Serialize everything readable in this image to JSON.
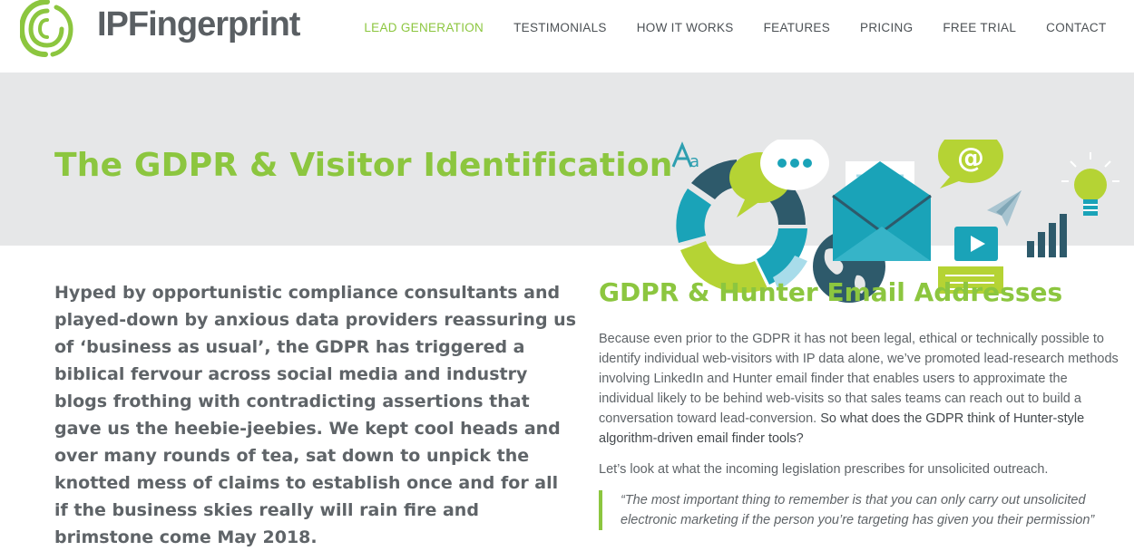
{
  "brand": {
    "logo_ip": "IP",
    "logo_fingerprint": "Fingerprint",
    "colors": {
      "accent_green": "#8cc63f",
      "dark_teal": "#2e5a6b",
      "teal": "#1aa3b8",
      "gray_text": "#5f6468",
      "hero_bg": "#e6e7e8"
    }
  },
  "nav": {
    "items": [
      {
        "label": "LEAD GENERATION",
        "active": true
      },
      {
        "label": "TESTIMONIALS"
      },
      {
        "label": "HOW IT WORKS"
      },
      {
        "label": "FEATURES"
      },
      {
        "label": "PRICING"
      },
      {
        "label": "FREE TRIAL"
      },
      {
        "label": "CONTACT"
      }
    ]
  },
  "hero": {
    "title": "The GDPR & Visitor Identification",
    "art_icons": [
      "font-icon",
      "donut-chart-icon",
      "speech-bubble-icon",
      "envelope-icon",
      "at-sign-icon",
      "lightbulb-icon",
      "paper-plane-icon",
      "globe-icon",
      "video-play-icon",
      "bar-chart-icon",
      "chat-card-icon"
    ]
  },
  "intro": {
    "text": "Hyped by opportunistic compliance consultants and played-down by anxious data providers reassuring us of ‘business as usual’, the GDPR has triggered a biblical fervour across social media and industry blogs frothing with contradicting assertions that gave us the heebie-jeebies. We kept cool heads and over many rounds of tea, sat down to unpick the knotted mess of claims to establish once and for all if the business skies really will rain fire and brimstone come May 2018."
  },
  "section": {
    "title": "GDPR & Hunter Email Addresses",
    "para1": "Because even prior to the GDPR it has not been legal, ethical or technically possible to identify individual web-visitors with IP data alone, we’ve promoted lead-research methods involving LinkedIn and Hunter email finder that enables users to approximate the individual likely to be behind web-visits so that sales teams can reach out to build a conversation toward lead-conversion.",
    "para1_strong": "So what does the GDPR think of Hunter-style algorithm-driven email finder tools?",
    "para2": "Let’s look at what the incoming legislation prescribes for unsolicited outreach.",
    "quote": "“The most important thing to remember is that you can only carry out unsolicited electronic marketing if the person you’re targeting has given you their permission”"
  }
}
